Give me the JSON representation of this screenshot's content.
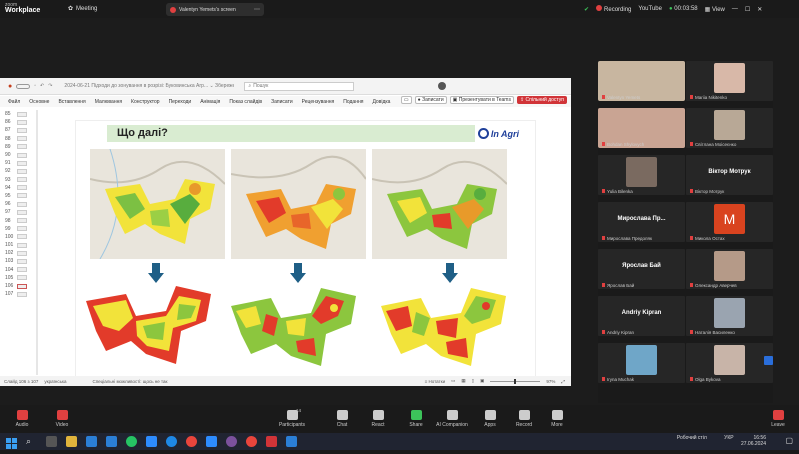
{
  "zoom": {
    "brand_top": "zoom",
    "brand_bottom": "Workplace",
    "meeting_label": "Meeting"
  },
  "share_tab": {
    "label": "Valentyn Yemets's screen"
  },
  "status_bar": {
    "recording": "Recording",
    "youtube": "YouTube",
    "timer": "00:03:58",
    "view": "View"
  },
  "ppt": {
    "filename": "2024-06-21 Підходи до зонування в розрізі: Буковинська Агр...  ⌄  Збережено на цей ПК",
    "search_placeholder": "Пошук",
    "menu": [
      "Файл",
      "Основне",
      "Вставлення",
      "Малювання",
      "Конструктор",
      "Переходи",
      "Анімація",
      "Показ слайдів",
      "Записати",
      "Рецензування",
      "Подання",
      "Довідка"
    ],
    "btn_record": "Записати",
    "btn_teams": "Презентувати в Teams",
    "btn_share": "Спільний доступ",
    "slide_numbers": [
      "85",
      "86",
      "87",
      "88",
      "89",
      "90",
      "91",
      "92",
      "93",
      "94",
      "95",
      "96",
      "97",
      "98",
      "99",
      "100",
      "101",
      "102",
      "103",
      "104",
      "105",
      "106",
      "107"
    ],
    "selected_slide": "106",
    "statusbar_left": "Слайд 106 з 107",
    "statusbar_lang": "українська",
    "statusbar_note": "Спеціальні можливості: щось не так",
    "statusbar_notes": "Нотатки",
    "zoom_pct": "97%"
  },
  "slide": {
    "title": "Що далі?",
    "logo_text": "In Agri",
    "arrow_color": "#1f5f86"
  },
  "participants": [
    {
      "name": "Valentyn Yemets",
      "kind": "video",
      "color": "#c8b6a0"
    },
    {
      "name": "Mariia Nikitenko",
      "kind": "video",
      "color": "#d8b8a8"
    },
    {
      "name": "Bohdan Shylovych",
      "kind": "video",
      "color": "#c9a493"
    },
    {
      "name": "Світлана Моісеєнко",
      "kind": "video",
      "color": "#b8a896"
    },
    {
      "name": "Yulia Bilenka",
      "kind": "video",
      "color": "#7a6a60"
    },
    {
      "name": "Віктор Мотрук",
      "kind": "name"
    },
    {
      "name": "Мирослава Пр...",
      "kind": "name",
      "full": "Мирослава Предоляк"
    },
    {
      "name": "Микола Остах",
      "kind": "avatar",
      "initial": "M",
      "color": "#d9431f"
    },
    {
      "name": "Ярослав Бай",
      "kind": "name"
    },
    {
      "name": "Олександр Аверчев",
      "kind": "video",
      "color": "#b59a88"
    },
    {
      "name": "Andriy Kipran",
      "kind": "name"
    },
    {
      "name": "Наталія Василенко",
      "kind": "video",
      "color": "#9aa4b0"
    },
    {
      "name": "Iryna Muchak",
      "kind": "video",
      "color": "#6fa6c8"
    },
    {
      "name": "Olga Bykova",
      "kind": "video",
      "color": "#c8b4a8"
    }
  ],
  "toolbar": [
    {
      "label": "Audio"
    },
    {
      "label": "Video"
    },
    {
      "label": "Participants",
      "count": "14"
    },
    {
      "label": "Chat"
    },
    {
      "label": "React"
    },
    {
      "label": "Share"
    },
    {
      "label": "AI Companion"
    },
    {
      "label": "Apps"
    },
    {
      "label": "Record"
    },
    {
      "label": "More"
    },
    {
      "label": "Leave"
    }
  ],
  "taskbar": {
    "desktop_label": "Робочий стіл",
    "lang": "УКР",
    "time": "16:56",
    "date": "27.06.2024"
  }
}
